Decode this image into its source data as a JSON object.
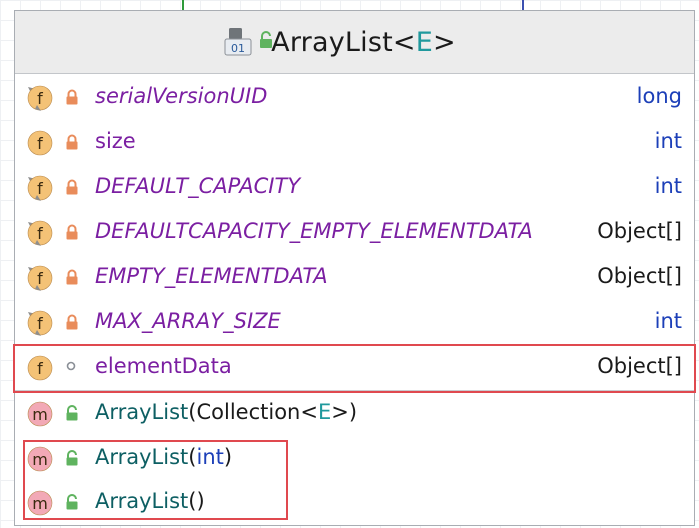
{
  "diagram": {
    "class_name": "ArrayList",
    "type_param": "E",
    "colors": {
      "field_name": "#7b1fa2",
      "primitive_type": "#1c3fb8",
      "method_name": "#0d5f63",
      "type_param": "#20999d",
      "highlight": "#e0494f",
      "field_icon": "#f4c276",
      "method_icon": "#f2a9b6",
      "private_lock": "#e98c5b",
      "public_lock": "#5fb35f"
    },
    "fields": [
      {
        "icon": "final-static-field-icon",
        "icon_letter": "f",
        "access": "private",
        "name": "serialVersionUID",
        "type": "long",
        "italic": true,
        "primitive": true
      },
      {
        "icon": "field-icon",
        "icon_letter": "f",
        "access": "private",
        "name": "size",
        "type": "int",
        "italic": false,
        "primitive": true
      },
      {
        "icon": "final-static-field-icon",
        "icon_letter": "f",
        "access": "private",
        "name": "DEFAULT_CAPACITY",
        "type": "int",
        "italic": true,
        "primitive": true
      },
      {
        "icon": "final-static-field-icon",
        "icon_letter": "f",
        "access": "private",
        "name": "DEFAULTCAPACITY_EMPTY_ELEMENTDATA",
        "type": "Object[]",
        "italic": true,
        "primitive": false
      },
      {
        "icon": "final-static-field-icon",
        "icon_letter": "f",
        "access": "private",
        "name": "EMPTY_ELEMENTDATA",
        "type": "Object[]",
        "italic": true,
        "primitive": false
      },
      {
        "icon": "final-static-field-icon",
        "icon_letter": "f",
        "access": "private",
        "name": "MAX_ARRAY_SIZE",
        "type": "int",
        "italic": true,
        "primitive": true
      },
      {
        "icon": "field-icon",
        "icon_letter": "f",
        "access": "package",
        "name": "elementData",
        "type": "Object[]",
        "italic": false,
        "primitive": false,
        "highlighted": true
      }
    ],
    "constructors": [
      {
        "icon": "method-icon",
        "icon_letter": "m",
        "access": "public",
        "name": "ArrayList",
        "open": "(",
        "param": "Collection",
        "generic_open": "<",
        "generic": "E",
        "generic_close": ">",
        "close": ")"
      },
      {
        "icon": "method-icon",
        "icon_letter": "m",
        "access": "public",
        "name": "ArrayList",
        "open": "(",
        "param": "int",
        "close": ")",
        "highlighted": true
      },
      {
        "icon": "method-icon",
        "icon_letter": "m",
        "access": "public",
        "name": "ArrayList",
        "open": "(",
        "param": "",
        "close": ")",
        "highlighted": true
      }
    ]
  }
}
